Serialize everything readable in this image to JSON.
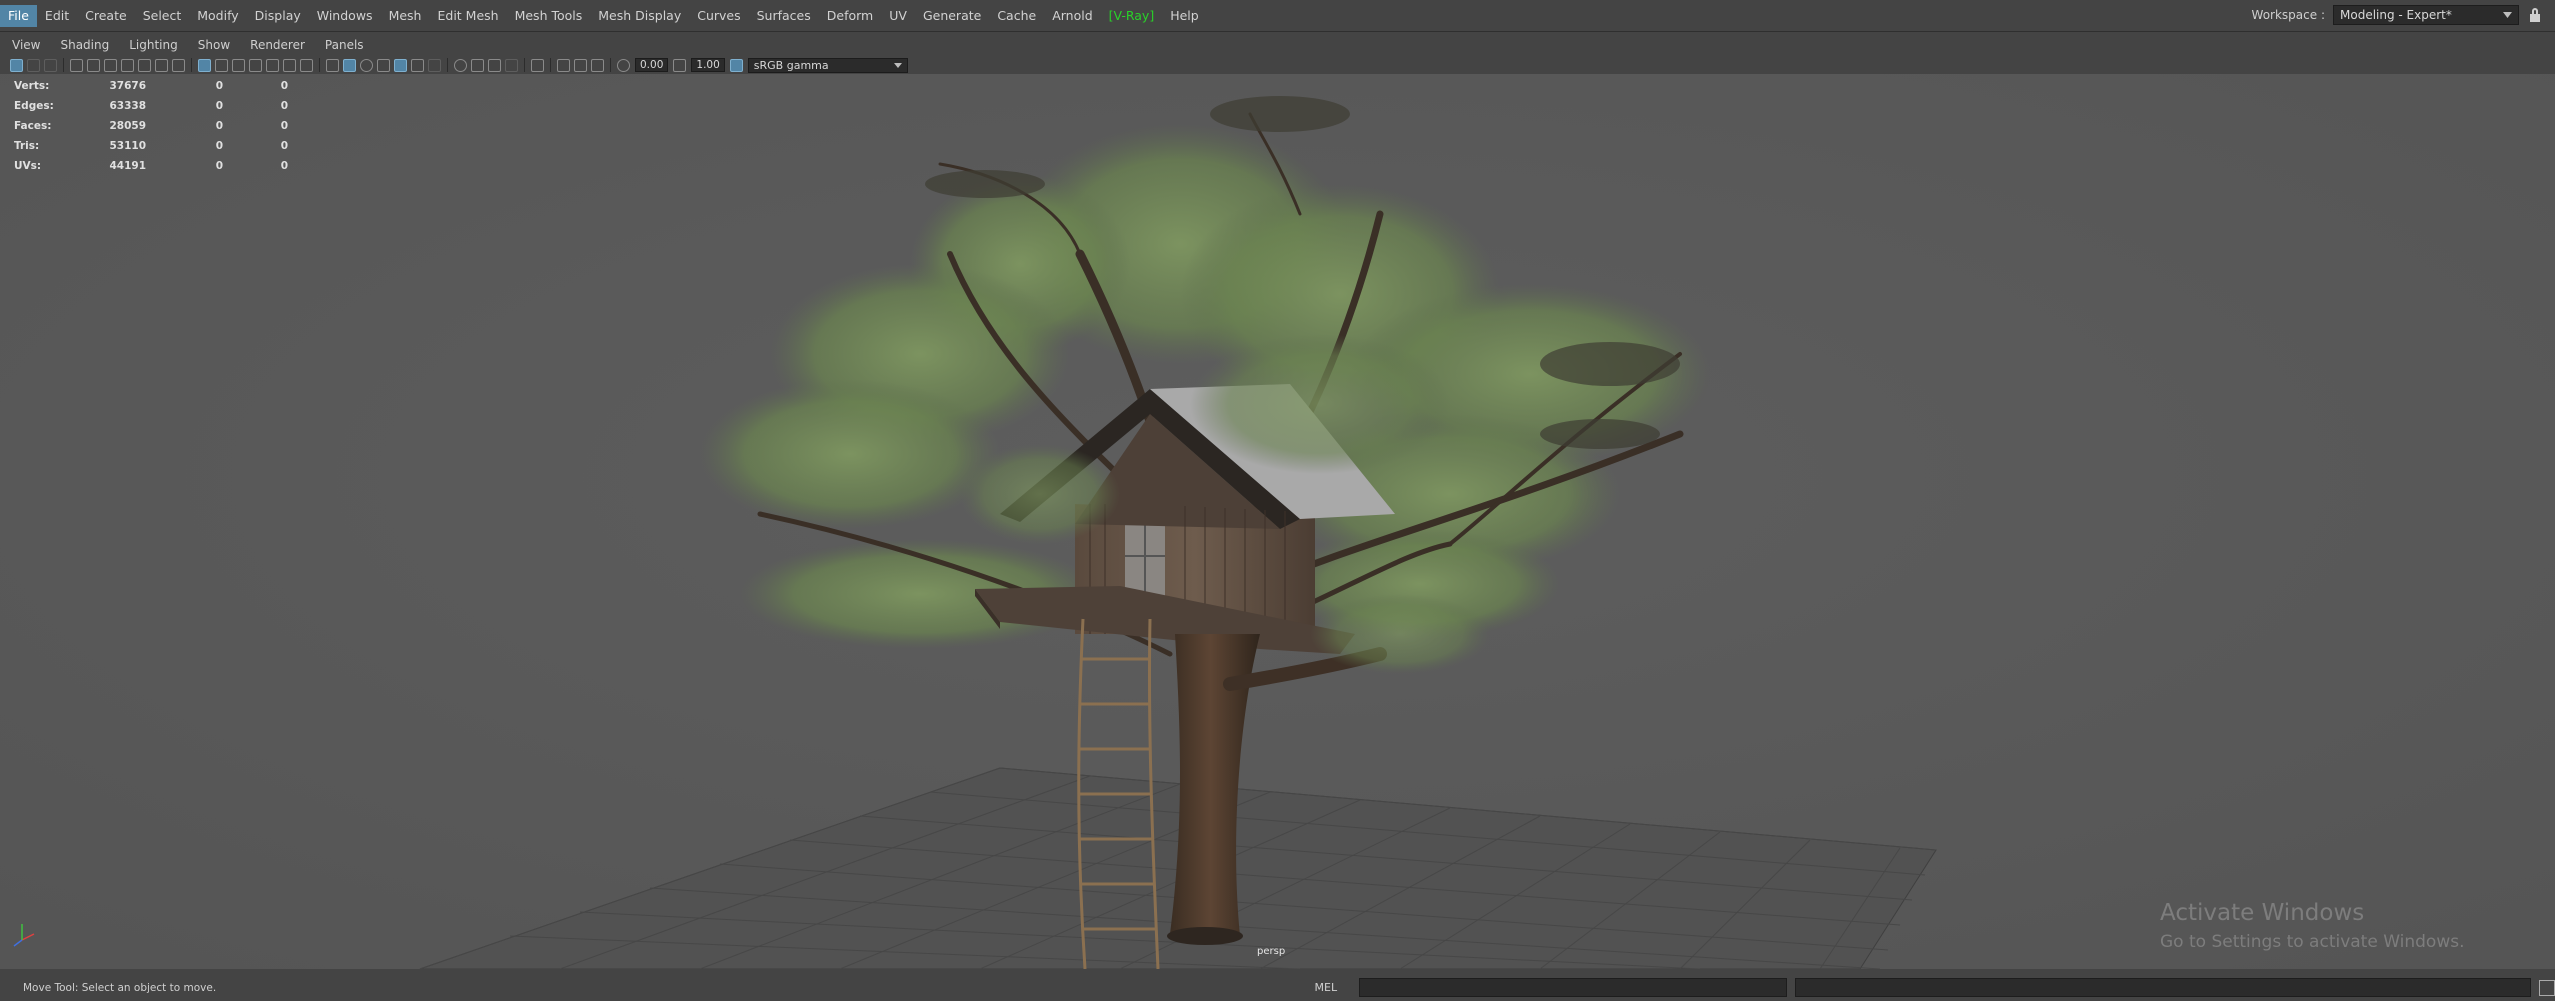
{
  "menubar": {
    "items": [
      "File",
      "Edit",
      "Create",
      "Select",
      "Modify",
      "Display",
      "Windows",
      "Mesh",
      "Edit Mesh",
      "Mesh Tools",
      "Mesh Display",
      "Curves",
      "Surfaces",
      "Deform",
      "UV",
      "Generate",
      "Cache",
      "Arnold",
      "[V-Ray]",
      "Help"
    ],
    "workspace_label": "Workspace :",
    "workspace_value": "Modeling - Expert*"
  },
  "panel_menu": {
    "items": [
      "View",
      "Shading",
      "Lighting",
      "Show",
      "Renderer",
      "Panels"
    ]
  },
  "toolbar": {
    "exposure_value": "0.00",
    "gamma_value": "1.00",
    "color_space": "sRGB gamma"
  },
  "hud": {
    "rows": [
      {
        "label": "Verts:",
        "v1": "37676",
        "v2": "0",
        "v3": "0"
      },
      {
        "label": "Edges:",
        "v1": "63338",
        "v2": "0",
        "v3": "0"
      },
      {
        "label": "Faces:",
        "v1": "28059",
        "v2": "0",
        "v3": "0"
      },
      {
        "label": "Tris:",
        "v1": "53110",
        "v2": "0",
        "v3": "0"
      },
      {
        "label": "UVs:",
        "v1": "44191",
        "v2": "0",
        "v3": "0"
      }
    ]
  },
  "viewport": {
    "camera_label": "persp",
    "watermark_title": "Activate Windows",
    "watermark_subtitle": "Go to Settings to activate Windows."
  },
  "statusbar": {
    "help_text": "Move Tool: Select an object to move.",
    "script_language": "MEL"
  },
  "colors": {
    "ui_bg": "#444444",
    "viewport_bg": "#595959",
    "selection_blue": "#5285a6",
    "vray_green": "#29d129",
    "grid_line": "#3e3e3e"
  }
}
